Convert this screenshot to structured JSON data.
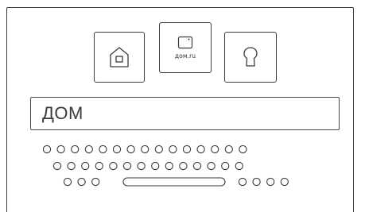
{
  "app_tiles": [
    {
      "id": "home",
      "icon": "home-icon",
      "label": ""
    },
    {
      "id": "domru",
      "icon": "intercom-device-icon",
      "label": "дом.ru"
    },
    {
      "id": "key",
      "icon": "keyhole-icon",
      "label": ""
    }
  ],
  "search": {
    "value": "ДОМ",
    "placeholder": ""
  },
  "keyboard": {
    "rows": [
      {
        "row": 1,
        "key_count": 15
      },
      {
        "row": 2,
        "key_count": 14
      },
      {
        "row": 3,
        "keys_before_space": 3,
        "has_space_bar": true,
        "keys_after_space": 4
      }
    ]
  },
  "colors": {
    "stroke": "#3a3a3a",
    "background": "#ffffff"
  }
}
